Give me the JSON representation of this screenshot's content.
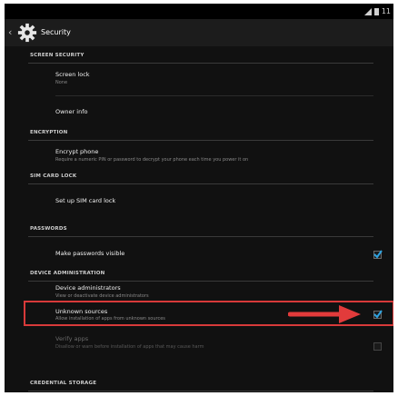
{
  "status": {
    "time": "11"
  },
  "header": {
    "title": "Security"
  },
  "sections": {
    "screen_security": "SCREEN SECURITY",
    "encryption": "ENCRYPTION",
    "sim_card_lock": "SIM CARD LOCK",
    "passwords": "PASSWORDS",
    "device_administration": "DEVICE ADMINISTRATION",
    "credential_storage": "CREDENTIAL STORAGE"
  },
  "items": {
    "screen_lock": {
      "title": "Screen lock",
      "subtitle": "None"
    },
    "owner_info": {
      "title": "Owner info"
    },
    "encrypt_phone": {
      "title": "Encrypt phone",
      "subtitle": "Require a numeric PIN or password to decrypt your phone each time you power it on"
    },
    "sim_lock": {
      "title": "Set up SIM card lock"
    },
    "make_passwords_visible": {
      "title": "Make passwords visible",
      "checked": true
    },
    "device_administrators": {
      "title": "Device administrators",
      "subtitle": "View or deactivate device administrators"
    },
    "unknown_sources": {
      "title": "Unknown sources",
      "subtitle": "Allow installation of apps from unknown sources",
      "checked": true
    },
    "verify_apps": {
      "title": "Verify apps",
      "subtitle": "Disallow or warn before installation of apps that may cause harm",
      "checked": false
    }
  },
  "colors": {
    "highlight": "#d83a3a",
    "checkmark": "#2ea3e0",
    "background": "#111111"
  }
}
